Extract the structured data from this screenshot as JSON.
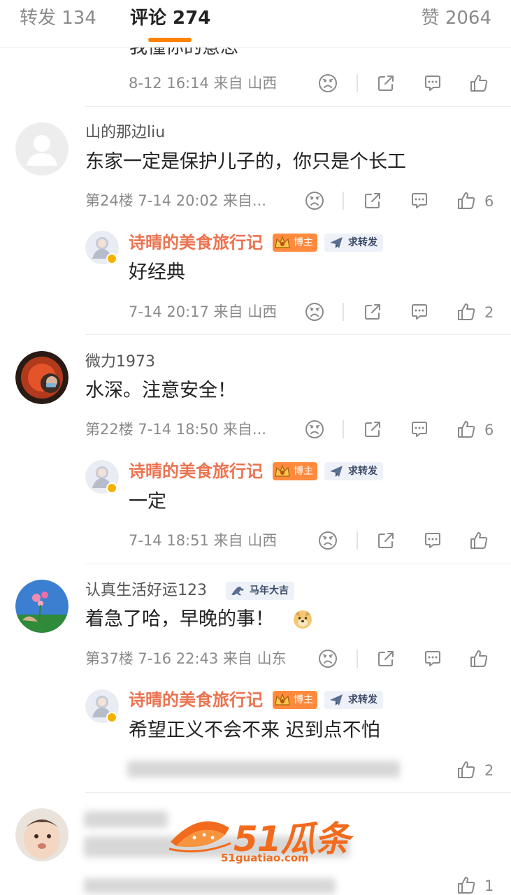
{
  "tabs": {
    "repost": "转发 134",
    "comments": "评论 274",
    "likes": "赞 2064"
  },
  "colors": {
    "accent": "#ff8200",
    "reply_name": "#eb7350",
    "meta_gray": "#8a8a8a"
  },
  "partial_comment": {
    "text": "我懂你的意思",
    "meta": "8-12 16:14 来自 山西"
  },
  "comments": [
    {
      "username": "山的那边liu",
      "text": "东家一定是保护儿子的，你只是个长工",
      "meta": "第24楼 7-14 20:02 来自...",
      "likes": "6",
      "reply": {
        "username": "诗晴的美食旅行记",
        "badges": [
          "博主",
          "求转发"
        ],
        "text": "好经典",
        "meta": "7-14 20:17 来自 山西",
        "likes": "2"
      }
    },
    {
      "username": "微力1973",
      "text": "水深。注意安全！",
      "meta": "第22楼 7-14 18:50 来自...",
      "likes": "6",
      "reply": {
        "username": "诗晴的美食旅行记",
        "badges": [
          "博主",
          "求转发"
        ],
        "text": "一定",
        "meta": "7-14 18:51 来自 山西",
        "likes": ""
      }
    },
    {
      "username": "认真生活好运123",
      "user_badge": "马年大吉",
      "text": "着急了哈，早晚的事！",
      "meta": "第37楼 7-16 22:43 来自 山东",
      "likes": "",
      "reply": {
        "username": "诗晴的美食旅行记",
        "badges": [
          "博主",
          "求转发"
        ],
        "text": "希望正义不会不来 迟到点不怕",
        "meta": "",
        "likes": "2"
      }
    }
  ],
  "last_comment": {
    "likes": "1"
  },
  "watermark": {
    "text": "51瓜条",
    "url": "51guatiao.com"
  },
  "icons": [
    "sad-face-icon",
    "share-icon",
    "comment-icon",
    "thumbs-up-icon",
    "crown-icon",
    "paper-plane-icon",
    "horse-icon",
    "doge-emoji-icon",
    "verified-icon"
  ]
}
